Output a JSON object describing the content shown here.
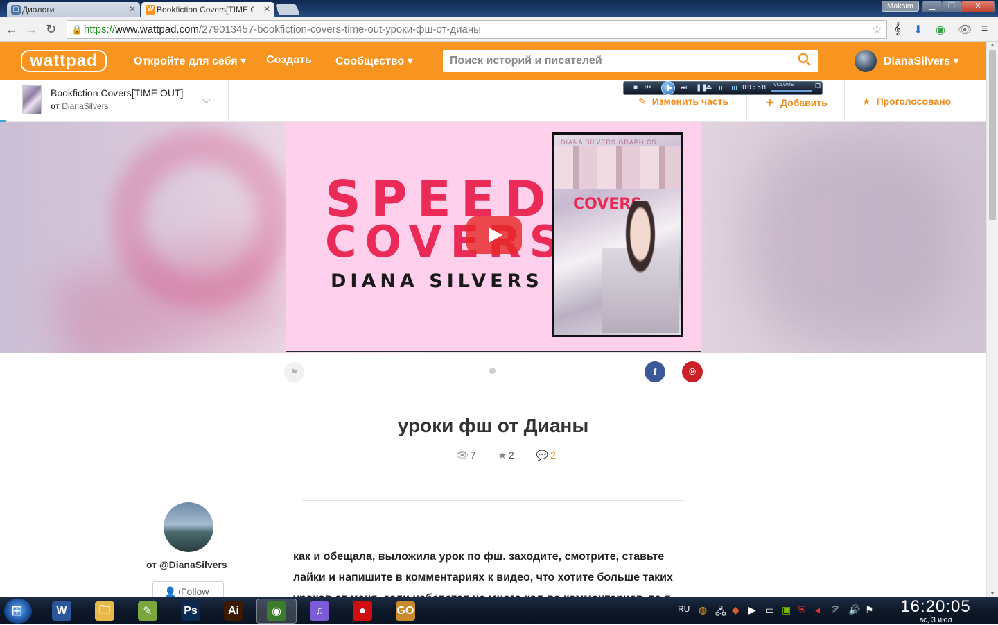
{
  "browser": {
    "tabs": [
      {
        "title": "Диалоги",
        "active": false,
        "favicon_color": "#4a76a8"
      },
      {
        "title": "Bookfiction Covers[TIME O",
        "active": true,
        "favicon_color": "#f89520"
      }
    ],
    "profile_name": "Maksim",
    "url": {
      "scheme": "https://",
      "host": "www.wattpad.com",
      "path": "/279013457-bookfiction-covers-time-out-уроки-фш-от-дианы"
    }
  },
  "wattpad": {
    "logo": "wattpad",
    "nav": {
      "discover": "Откройте для себя",
      "create": "Создать",
      "community": "Сообщество"
    },
    "search_placeholder": "Поиск историй и писателей",
    "user": "DianaSilvers",
    "accent_color": "#f89520"
  },
  "story": {
    "title": "Bookfiction Covers[TIME OUT]",
    "by_prefix": "от",
    "author": "DianaSilvers",
    "actions": {
      "edit": "Изменить часть",
      "add": "Добавить",
      "voted": "Проголосовано"
    }
  },
  "video": {
    "line1": "SPEED",
    "line2": "COVERS",
    "line3": "DIANA SILVERS",
    "poster_header": "DIANA SILVERS GRAPHICS",
    "poster_vertical": "COVERS",
    "player_time": "00:58",
    "player_volume_label": "VOLUME"
  },
  "part": {
    "title": "уроки фш от Дианы",
    "views": "7",
    "votes": "2",
    "comments": "2",
    "byline": "от @DianaSilvers",
    "follow": "Follow",
    "text": "как и обещала, выложила урок по фш. заходите, смотрите, ставьте лайки и напишите в комментариях к видео, что хотите больше таких уроков от меня, если наберется не много кол-во комментариев, то я продолжу"
  },
  "share": {
    "facebook": "f",
    "pinterest": "℗"
  },
  "taskbar": {
    "apps": [
      {
        "name": "word",
        "label": "W",
        "color": "#2b579a",
        "active": false
      },
      {
        "name": "explorer",
        "label": "🗀",
        "color": "#e7b84a",
        "active": false
      },
      {
        "name": "paint",
        "label": "✎",
        "color": "#7aa83c",
        "active": false
      },
      {
        "name": "photoshop",
        "label": "Ps",
        "color": "#0b2a52",
        "active": false
      },
      {
        "name": "illustrator",
        "label": "Ai",
        "color": "#3a1a00",
        "active": false
      },
      {
        "name": "chrome",
        "label": "◉",
        "color": "#3a7d2c",
        "active": true
      },
      {
        "name": "itunes",
        "label": "♫",
        "color": "#7c5cd6",
        "active": false
      },
      {
        "name": "recorder",
        "label": "●",
        "color": "#d01010",
        "active": false
      },
      {
        "name": "csgo",
        "label": "GO",
        "color": "#c88a2a",
        "active": false
      }
    ],
    "language": "RU",
    "time": "16:20:05",
    "date": "вс, 3 июл"
  }
}
